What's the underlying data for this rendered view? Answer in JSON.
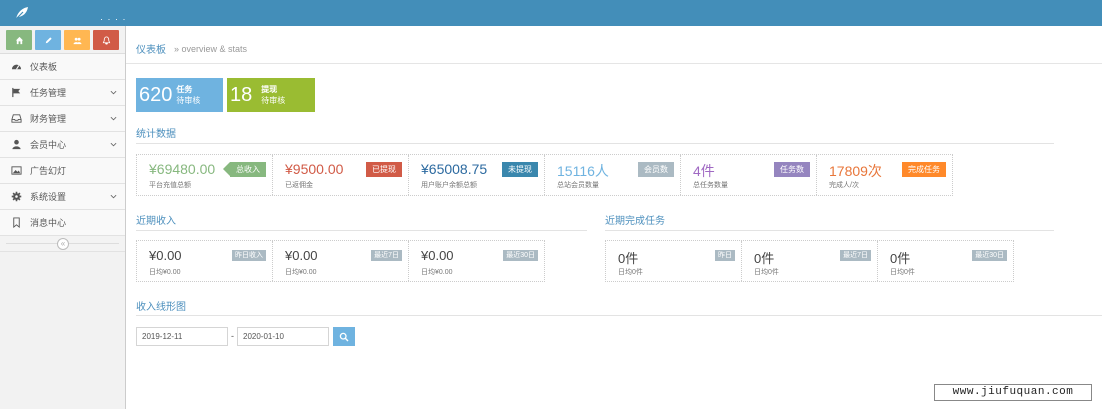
{
  "navbar": {
    "brand_icon": "leaf-icon",
    "dots": "· · · ·"
  },
  "sidebar": {
    "shortcuts": [
      {
        "name": "home",
        "icon": "home-icon",
        "color": "#87b87f"
      },
      {
        "name": "pencil",
        "icon": "pencil-icon",
        "color": "#6fb3e0"
      },
      {
        "name": "users",
        "icon": "users-icon",
        "color": "#ffb752"
      },
      {
        "name": "bell",
        "icon": "bell-icon",
        "color": "#d15b47"
      }
    ],
    "items": [
      {
        "label": "仪表板",
        "icon": "dashboard-icon",
        "expandable": false
      },
      {
        "label": "任务管理",
        "icon": "flag-icon",
        "expandable": true
      },
      {
        "label": "财务管理",
        "icon": "inbox-icon",
        "expandable": true
      },
      {
        "label": "会员中心",
        "icon": "user-icon",
        "expandable": true
      },
      {
        "label": "广告幻灯",
        "icon": "picture-icon",
        "expandable": false
      },
      {
        "label": "系统设置",
        "icon": "gear-icon",
        "expandable": true
      },
      {
        "label": "消息中心",
        "icon": "bookmark-icon",
        "expandable": false
      }
    ],
    "collapse_glyph": "«"
  },
  "breadcrumb": {
    "home": "仪表板",
    "current": "» overview & stats"
  },
  "tiles": [
    {
      "num": "620",
      "title": "任务",
      "sub": "待审核",
      "color": "#6fb3e0"
    },
    {
      "num": "18",
      "title": "提现",
      "sub": "待审核",
      "color": "#9abc32"
    }
  ],
  "sections": {
    "stats": "统计数据",
    "recent_income": "近期收入",
    "recent_tasks": "近期完成任务",
    "income_chart": "收入线形图"
  },
  "stats": [
    {
      "value": "¥69480.00",
      "sub": "平台充值总额",
      "badge": "总收入",
      "value_color": "#87b87f",
      "badge_color": "#87b87f"
    },
    {
      "value": "¥9500.00",
      "sub": "已返佣金",
      "badge": "已提现",
      "value_color": "#d15b47",
      "badge_color": "#d15b47"
    },
    {
      "value": "¥65008.75",
      "sub": "用户账户余额总额",
      "badge": "未提现",
      "value_color": "#2c6aa0",
      "badge_color": "#3a87ad"
    },
    {
      "value": "15116人",
      "sub": "总站会员数量",
      "badge": "会员数",
      "value_color": "#6fb3e0",
      "badge_color": "#abbac3"
    },
    {
      "value": "4件",
      "sub": "总任务数量",
      "badge": "任务数",
      "value_color": "#a069c3",
      "badge_color": "#9585bf"
    },
    {
      "value": "17809次",
      "sub": "完成人/次",
      "badge": "完成任务",
      "value_color": "#f89406",
      "badge_color": "#ff892a"
    }
  ],
  "income": [
    {
      "value": "¥0.00",
      "sub": "日均¥0.00",
      "tag": "昨日收入"
    },
    {
      "value": "¥0.00",
      "sub": "日均¥0.00",
      "tag": "最近7日"
    },
    {
      "value": "¥0.00",
      "sub": "日均¥0.00",
      "tag": "最近30日"
    }
  ],
  "tasks": [
    {
      "value": "0件",
      "sub": "日均0件",
      "tag": "昨日"
    },
    {
      "value": "0件",
      "sub": "日均0件",
      "tag": "最近7日"
    },
    {
      "value": "0件",
      "sub": "日均0件",
      "tag": "最近30日"
    }
  ],
  "date_range": {
    "start": "2019-12-11",
    "separator": "-",
    "end": "2020-01-10",
    "search_icon": "search-icon"
  },
  "watermark": "www.jiufuquan.com"
}
